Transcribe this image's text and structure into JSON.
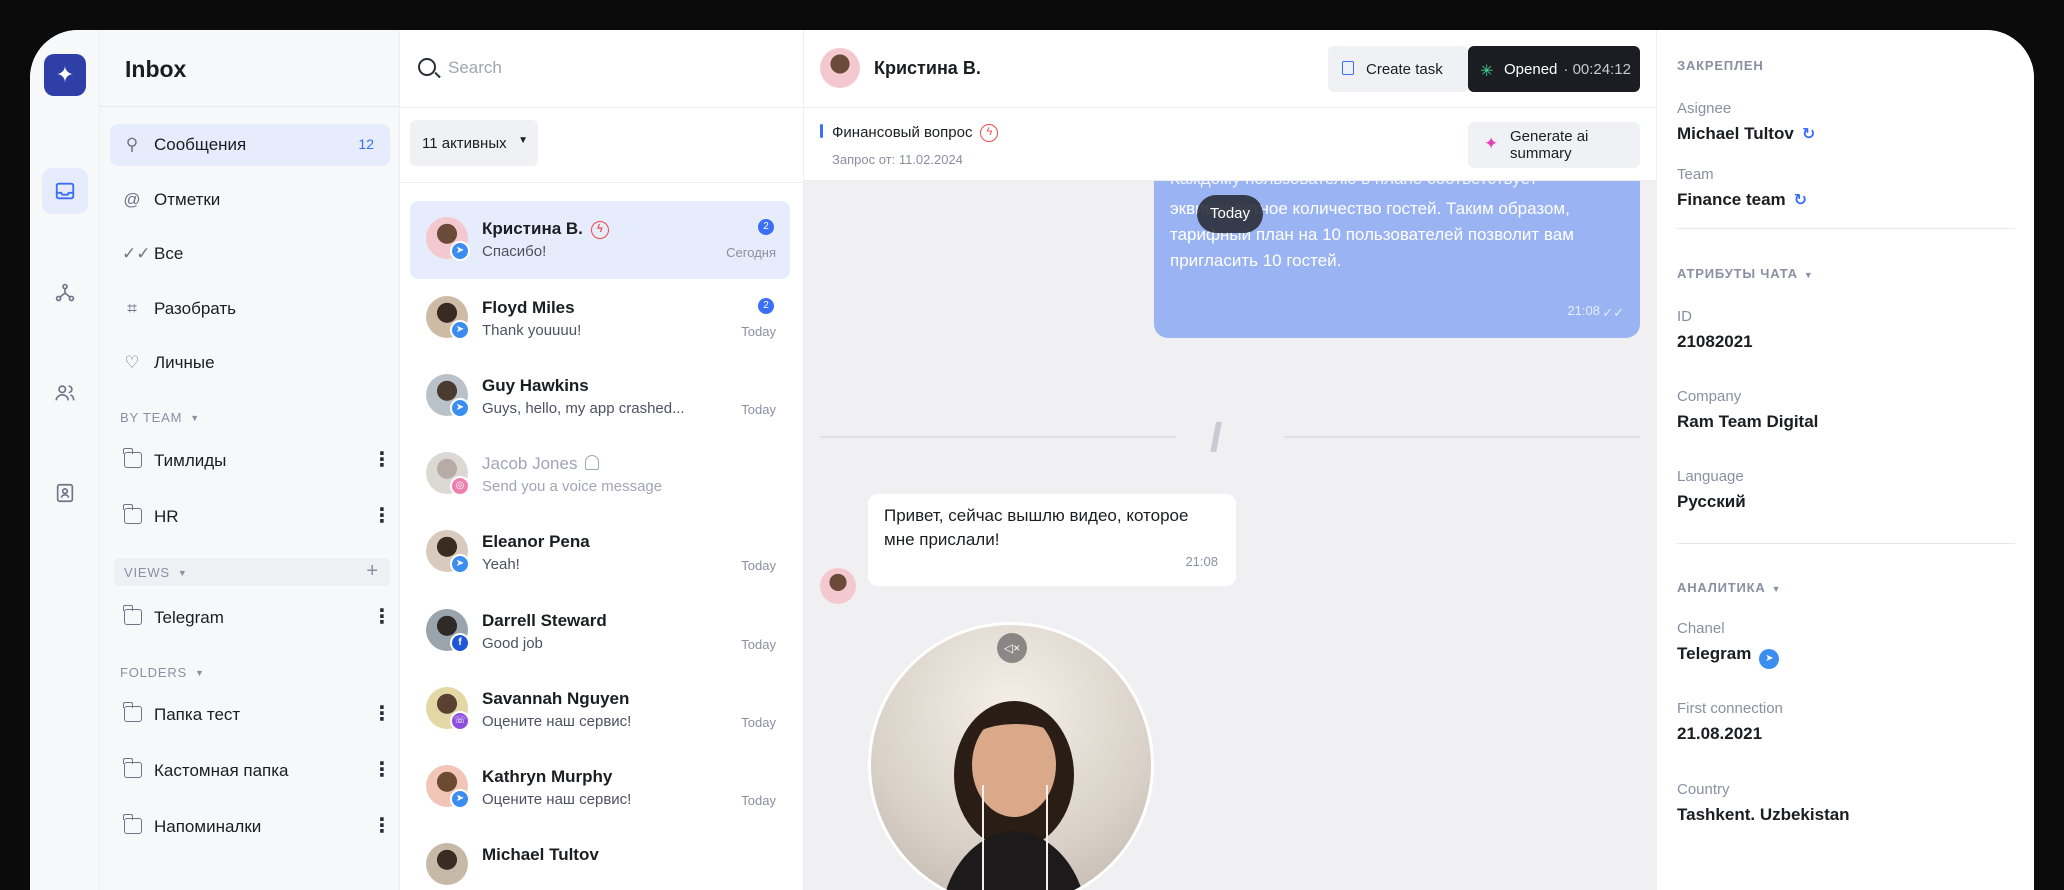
{
  "sidebar": {
    "title": "Inbox",
    "items": [
      {
        "label": "Сообщения",
        "count": "12",
        "icon": "user-icon"
      },
      {
        "label": "Отметки",
        "icon": "at-icon"
      },
      {
        "label": "Все",
        "icon": "double-check-icon"
      },
      {
        "label": "Разобрать",
        "icon": "scan-icon"
      },
      {
        "label": "Личные",
        "icon": "heart-icon"
      }
    ],
    "by_team_label": "BY TEAM",
    "teams": [
      "Тимлиды",
      "HR"
    ],
    "views_label": "VIEWS",
    "views": [
      "Telegram"
    ],
    "folders_label": "FOLDERS",
    "folders": [
      "Папка тест",
      "Кастомная папка",
      "Напоминалки"
    ]
  },
  "chat_list": {
    "search_placeholder": "Search",
    "filter_label": "11 активных",
    "conversations": [
      {
        "name": "Кристина В.",
        "message": "Спасибо!",
        "time": "Сегодня",
        "unread": "2",
        "channel": "telegram",
        "active": true,
        "urgent": true
      },
      {
        "name": "Floyd Miles",
        "message": "Thank youuuu!",
        "time": "Today",
        "unread": "2",
        "channel": "telegram"
      },
      {
        "name": "Guy Hawkins",
        "message": "Guys, hello, my app crashed...",
        "time": "Today",
        "channel": "telegram"
      },
      {
        "name": "Jacob Jones",
        "message": "Send you a voice message",
        "time": "",
        "channel": "instagram",
        "muted": true
      },
      {
        "name": "Eleanor Pena",
        "message": "Yeah!",
        "time": "Today",
        "channel": "telegram"
      },
      {
        "name": "Darrell Steward",
        "message": "Good job",
        "time": "Today",
        "channel": "facebook"
      },
      {
        "name": "Savannah Nguyen",
        "message": "Оцените наш сервис!",
        "time": "Today",
        "channel": "viber"
      },
      {
        "name": "Kathryn Murphy",
        "message": "Оцените наш сервис!",
        "time": "Today",
        "channel": "telegram"
      },
      {
        "name": "Michael Tultov",
        "message": "",
        "time": "",
        "channel": "telegram"
      }
    ]
  },
  "chat": {
    "contact_name": "Кристина В.",
    "create_task_label": "Create task",
    "status_label": "Opened",
    "status_timer": "00:24:12",
    "topic": "Финансовый вопрос",
    "request_date": "Запрос от: 11.02.2024",
    "ai_summary_label": "Generate ai summary",
    "out_message_cut": "Каждому пользователю в плане соответствует",
    "out_message": "эквивалентное количество гостей. Таким образом, тарифный план на 10 пользователей позволит вам пригласить 10 гостей.",
    "out_time": "21:08",
    "today_pill": "Today",
    "in_message": "Привет, сейчас вышлю видео, которое мне прислали!",
    "in_time": "21:08"
  },
  "details": {
    "pinned_label": "ЗАКРЕПЛЕН",
    "assignee_label": "Asignee",
    "assignee_value": "Michael Tultov",
    "team_label": "Team",
    "team_value": "Finance team",
    "attributes_label": "АТРИБУТЫ ЧАТА",
    "id_label": "ID",
    "id_value": "21082021",
    "company_label": "Company",
    "company_value": "Ram Team Digital",
    "language_label": "Language",
    "language_value": "Русский",
    "analytics_label": "АНАЛИТИКА",
    "channel_label": "Chanel",
    "channel_value": "Telegram",
    "first_connection_label": "First connection",
    "first_connection_value": "21.08.2021",
    "country_label": "Country",
    "country_value": "Tashkent. Uzbekistan"
  },
  "colors": {
    "accent": "#3b6ff5",
    "brand": "#2f3fa8",
    "outgoing_bubble": "#9ab3f3",
    "opened_indicator": "#3dd68c",
    "urgent": "#ef4b4b"
  }
}
